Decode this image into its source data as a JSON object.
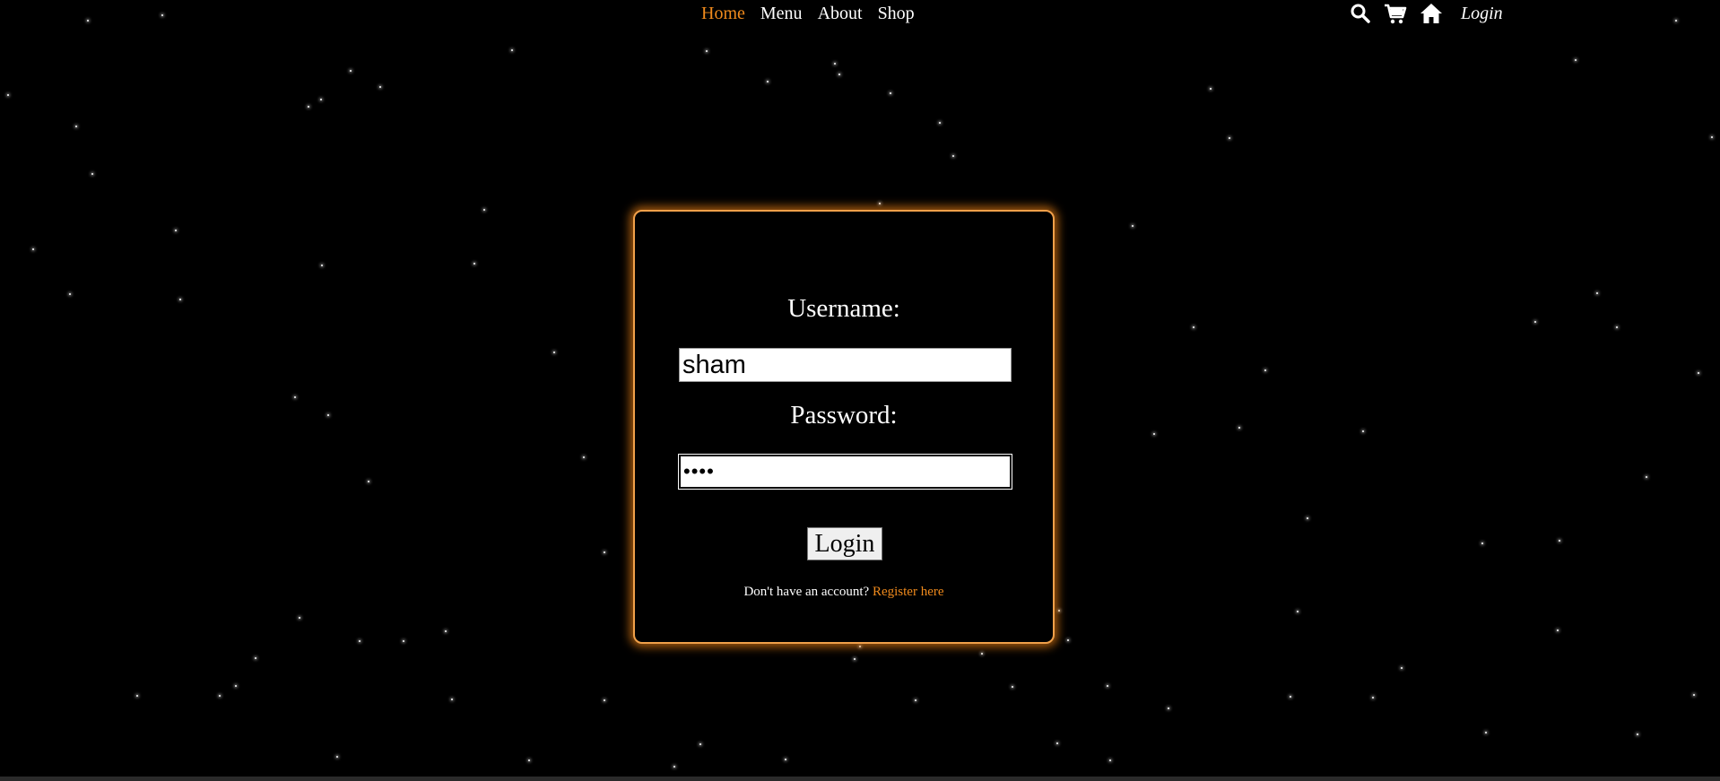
{
  "nav": {
    "links": [
      {
        "label": "Home",
        "active": true
      },
      {
        "label": "Menu",
        "active": false
      },
      {
        "label": "About",
        "active": false
      },
      {
        "label": "Shop",
        "active": false
      }
    ],
    "icons": [
      "search-icon",
      "cart-icon",
      "home-icon"
    ],
    "login_label": "Login"
  },
  "form": {
    "username_label": "Username:",
    "username_value": "sham",
    "password_label": "Password:",
    "password_value": "••••",
    "submit_label": "Login",
    "register_prompt": "Don't have an account?",
    "register_link": "Register here"
  },
  "colors": {
    "background": "#000000",
    "accent": "#f08a1c",
    "card_glow": "#f0a04a",
    "text": "#ffffff"
  }
}
